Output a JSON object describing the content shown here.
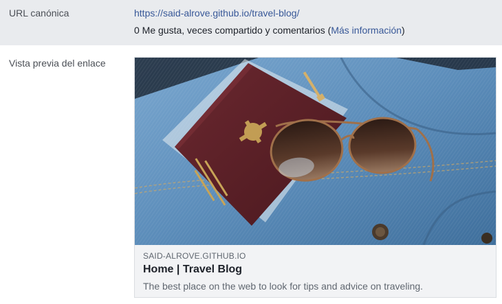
{
  "canonical": {
    "label": "URL canónica",
    "url": "https://said-alrove.github.io/travel-blog/",
    "stats_text": "0 Me gusta, veces compartido y comentarios (",
    "more_info_link": "Más información",
    "stats_close": ")"
  },
  "preview": {
    "label": "Vista previa del enlace",
    "card": {
      "image": "passport-and-sunglasses-on-denim-jacket",
      "domain": "SAID-ALROVE.GITHUB.IO",
      "title": "Home | Travel Blog",
      "description": "The best place on the web to look for tips and advice on traveling."
    }
  },
  "colors": {
    "link": "#385898",
    "row_bg": "#e9ebee",
    "card_bg": "#f2f3f5",
    "passport": "#5a2128",
    "denim": "#5f8fb8"
  }
}
